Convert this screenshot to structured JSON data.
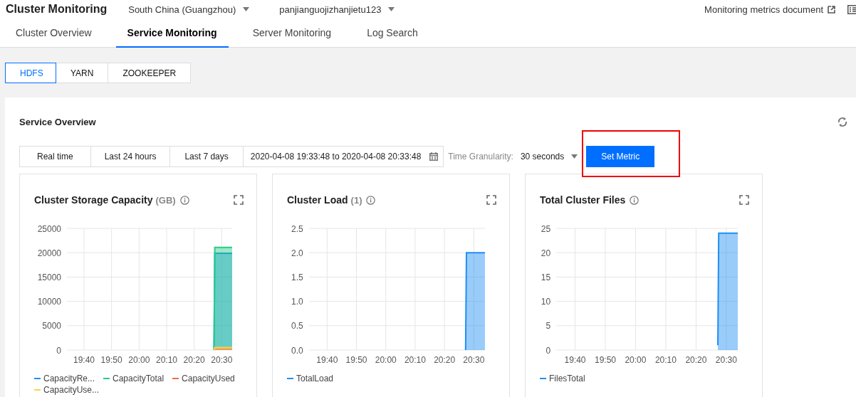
{
  "header": {
    "title": "Cluster Monitoring",
    "region": "South China (Guangzhou)",
    "cluster": "panjianguojizhanjietu123",
    "doc_link": "Monitoring metrics document"
  },
  "tabs": [
    {
      "label": "Cluster Overview",
      "selected": false
    },
    {
      "label": "Service Monitoring",
      "selected": true
    },
    {
      "label": "Server Monitoring",
      "selected": false
    },
    {
      "label": "Log Search",
      "selected": false
    }
  ],
  "service_tabs": [
    {
      "label": "HDFS",
      "selected": true
    },
    {
      "label": "YARN",
      "selected": false
    },
    {
      "label": "ZOOKEEPER",
      "selected": false
    }
  ],
  "section_title": "Service Overview",
  "time_ranges": [
    {
      "label": "Real time",
      "selected": false
    },
    {
      "label": "Last 24 hours",
      "selected": false
    },
    {
      "label": "Last 7 days",
      "selected": false
    }
  ],
  "date_range": "2020-04-08 19:33:48 to 2020-04-08 20:33:48",
  "granularity": {
    "label": "Time Granularity:",
    "value": "30 seconds"
  },
  "set_metric": {
    "label": "Set Metric",
    "highlighted": true
  },
  "charts": [
    {
      "title": "Cluster Storage Capacity",
      "unit": "(GB)",
      "chart_data": {
        "type": "area",
        "grid": true,
        "x": [
          1227.2,
          1227.5,
          1233.8
        ],
        "xlim": [
          1173.8,
          1233.8
        ],
        "ylim": [
          0,
          25000
        ],
        "xticks": [
          {
            "value": 1180,
            "label": "19:40"
          },
          {
            "value": 1190,
            "label": "19:50"
          },
          {
            "value": 1200,
            "label": "20:00"
          },
          {
            "value": 1210,
            "label": "20:10"
          },
          {
            "value": 1220,
            "label": "20:20"
          },
          {
            "value": 1230,
            "label": "20:30"
          }
        ],
        "yticks": [
          0,
          5000,
          10000,
          15000,
          20000,
          25000
        ],
        "series": [
          {
            "name": "CapacityRe...",
            "color": "#1e8ff5",
            "values": [
              0,
              19900,
              19900
            ]
          },
          {
            "name": "CapacityTotal",
            "color": "#29cc85",
            "values": [
              0,
              21100,
              21100
            ]
          },
          {
            "name": "CapacityUsed",
            "color": "#f4694a",
            "values": [
              0,
              200,
              200
            ]
          },
          {
            "name": "CapacityUse...",
            "color": "#ffd04d",
            "values": [
              0,
              500,
              500
            ]
          }
        ]
      }
    },
    {
      "title": "Cluster Load",
      "unit": "(1)",
      "chart_data": {
        "type": "area",
        "grid": true,
        "x": [
          1227.2,
          1227.5,
          1233.8
        ],
        "xlim": [
          1173.8,
          1233.8
        ],
        "ylim": [
          0,
          2.5
        ],
        "xticks": [
          {
            "value": 1180,
            "label": "19:40"
          },
          {
            "value": 1190,
            "label": "19:50"
          },
          {
            "value": 1200,
            "label": "20:00"
          },
          {
            "value": 1210,
            "label": "20:10"
          },
          {
            "value": 1220,
            "label": "20:20"
          },
          {
            "value": 1230,
            "label": "20:30"
          }
        ],
        "yticks": [
          {
            "value": 0,
            "label": "0.0"
          },
          {
            "value": 0.5,
            "label": "0.5"
          },
          {
            "value": 1,
            "label": "1.0"
          },
          {
            "value": 1.5,
            "label": "1.5"
          },
          {
            "value": 2,
            "label": "2.0"
          },
          {
            "value": 2.5,
            "label": "2.5"
          }
        ],
        "series": [
          {
            "name": "TotalLoad",
            "color": "#1e8ff5",
            "values": [
              0,
              2,
              2
            ]
          }
        ]
      }
    },
    {
      "title": "Total Cluster Files",
      "chart_data": {
        "type": "area",
        "grid": true,
        "x": [
          1227.2,
          1227.5,
          1233.8
        ],
        "xlim": [
          1173.8,
          1233.8
        ],
        "ylim": [
          0,
          25
        ],
        "xticks": [
          {
            "value": 1180,
            "label": "19:40"
          },
          {
            "value": 1190,
            "label": "19:50"
          },
          {
            "value": 1200,
            "label": "20:00"
          },
          {
            "value": 1210,
            "label": "20:10"
          },
          {
            "value": 1220,
            "label": "20:20"
          },
          {
            "value": 1230,
            "label": "20:30"
          }
        ],
        "yticks": [
          0,
          5,
          10,
          15,
          20,
          25
        ],
        "series": [
          {
            "name": "FilesTotal",
            "color": "#1e8ff5",
            "values": [
              1,
              24,
              24
            ]
          }
        ]
      }
    }
  ]
}
